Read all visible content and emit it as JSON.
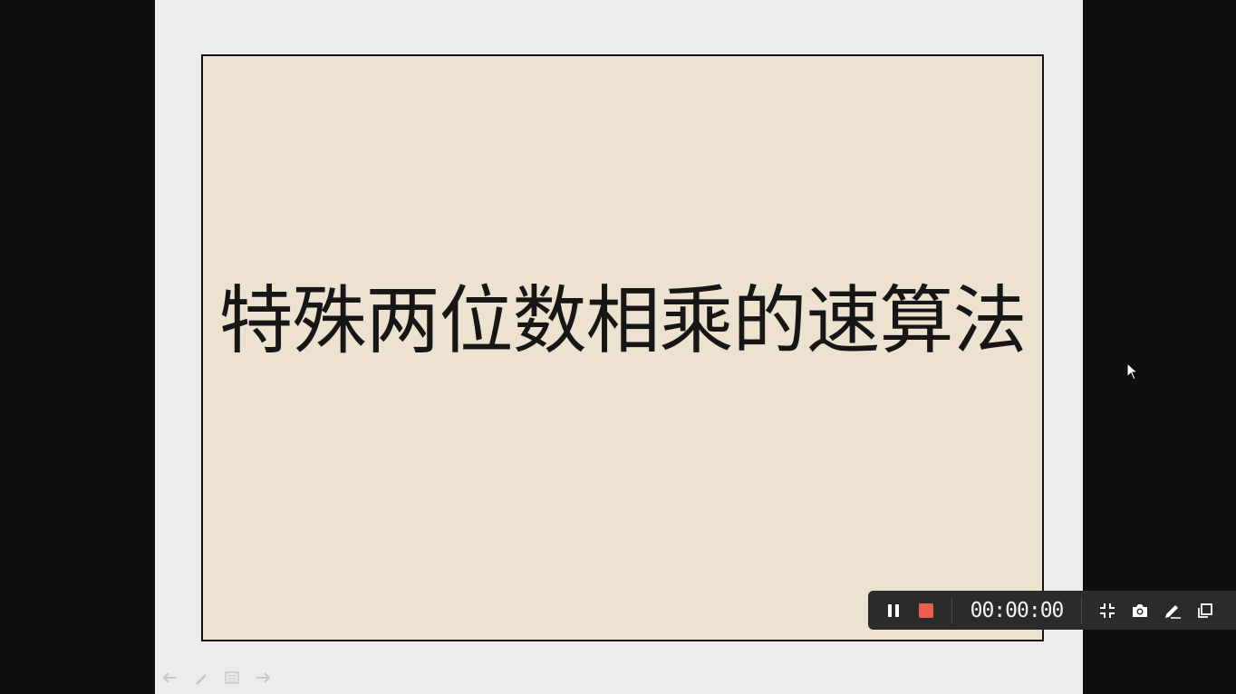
{
  "slide": {
    "title": "特殊两位数相乘的速算法"
  },
  "slide_nav": {
    "icons": [
      "arrow-left-icon",
      "pen-icon",
      "menu-icon",
      "arrow-right-icon"
    ]
  },
  "recorder": {
    "timer": "00:00:00",
    "stop_color": "#e8604c",
    "icons": [
      "pause-icon",
      "stop-icon",
      "shrink-icon",
      "camera-icon",
      "pen-icon",
      "window-icon"
    ]
  }
}
